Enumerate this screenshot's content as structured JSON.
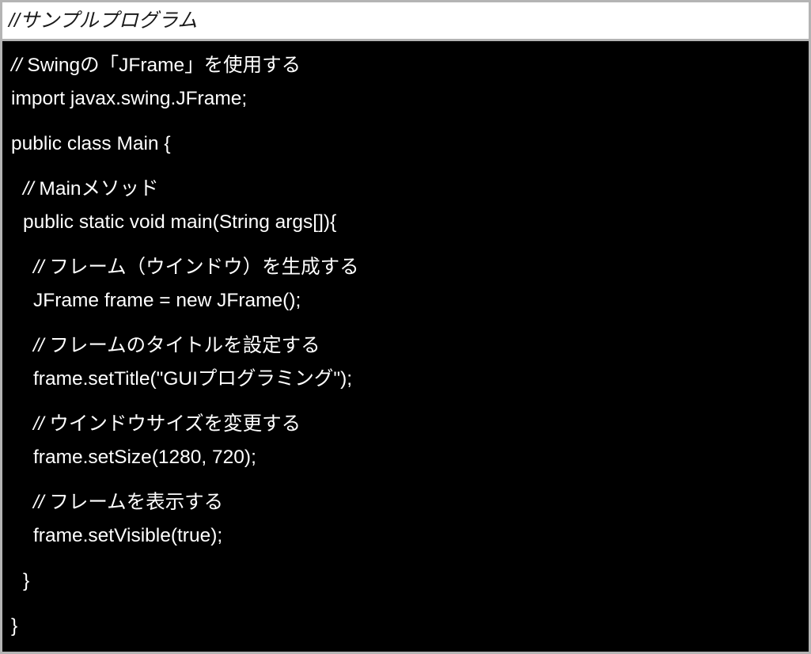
{
  "slide": {
    "title": "//サンプルプログラム",
    "background_color": "#000000",
    "header_background_color": "#ffffff",
    "border_color": "#b4b4b4",
    "text_color": "#ffffff",
    "header_text_color": "#1a1a1a"
  },
  "code": {
    "language": "Java",
    "lines": [
      {
        "slashes": "// ",
        "text": "Swingの「JFrame」を使用する",
        "indent": 0,
        "comment": true,
        "gap_before": false
      },
      {
        "slashes": "",
        "text": "import javax.swing.JFrame;",
        "indent": 0,
        "comment": false,
        "gap_before": false
      },
      {
        "slashes": "",
        "text": "public class Main {",
        "indent": 0,
        "comment": false,
        "gap_before": true
      },
      {
        "slashes": "// ",
        "text": "Mainメソッド",
        "indent": 1,
        "comment": true,
        "gap_before": true
      },
      {
        "slashes": "",
        "text": "public static void main(String args[]){",
        "indent": 1,
        "comment": false,
        "gap_before": false
      },
      {
        "slashes": "// ",
        "text": "フレーム（ウインドウ）を生成する",
        "indent": 2,
        "comment": true,
        "gap_before": true
      },
      {
        "slashes": "",
        "text": "JFrame frame = new JFrame();",
        "indent": 2,
        "comment": false,
        "gap_before": false
      },
      {
        "slashes": "// ",
        "text": "フレームのタイトルを設定する",
        "indent": 2,
        "comment": true,
        "gap_before": true
      },
      {
        "slashes": "",
        "text": "frame.setTitle(\"GUIプログラミング\");",
        "indent": 2,
        "comment": false,
        "gap_before": false
      },
      {
        "slashes": "// ",
        "text": "ウインドウサイズを変更する",
        "indent": 2,
        "comment": true,
        "gap_before": true
      },
      {
        "slashes": "",
        "text": "frame.setSize(1280, 720);",
        "indent": 2,
        "comment": false,
        "gap_before": false
      },
      {
        "slashes": "// ",
        "text": "フレームを表示する",
        "indent": 2,
        "comment": true,
        "gap_before": true
      },
      {
        "slashes": "",
        "text": "frame.setVisible(true);",
        "indent": 2,
        "comment": false,
        "gap_before": false
      },
      {
        "slashes": "",
        "text": "}",
        "indent": 1,
        "comment": false,
        "gap_before": true
      },
      {
        "slashes": "",
        "text": "}",
        "indent": 0,
        "comment": false,
        "gap_before": true
      }
    ]
  }
}
